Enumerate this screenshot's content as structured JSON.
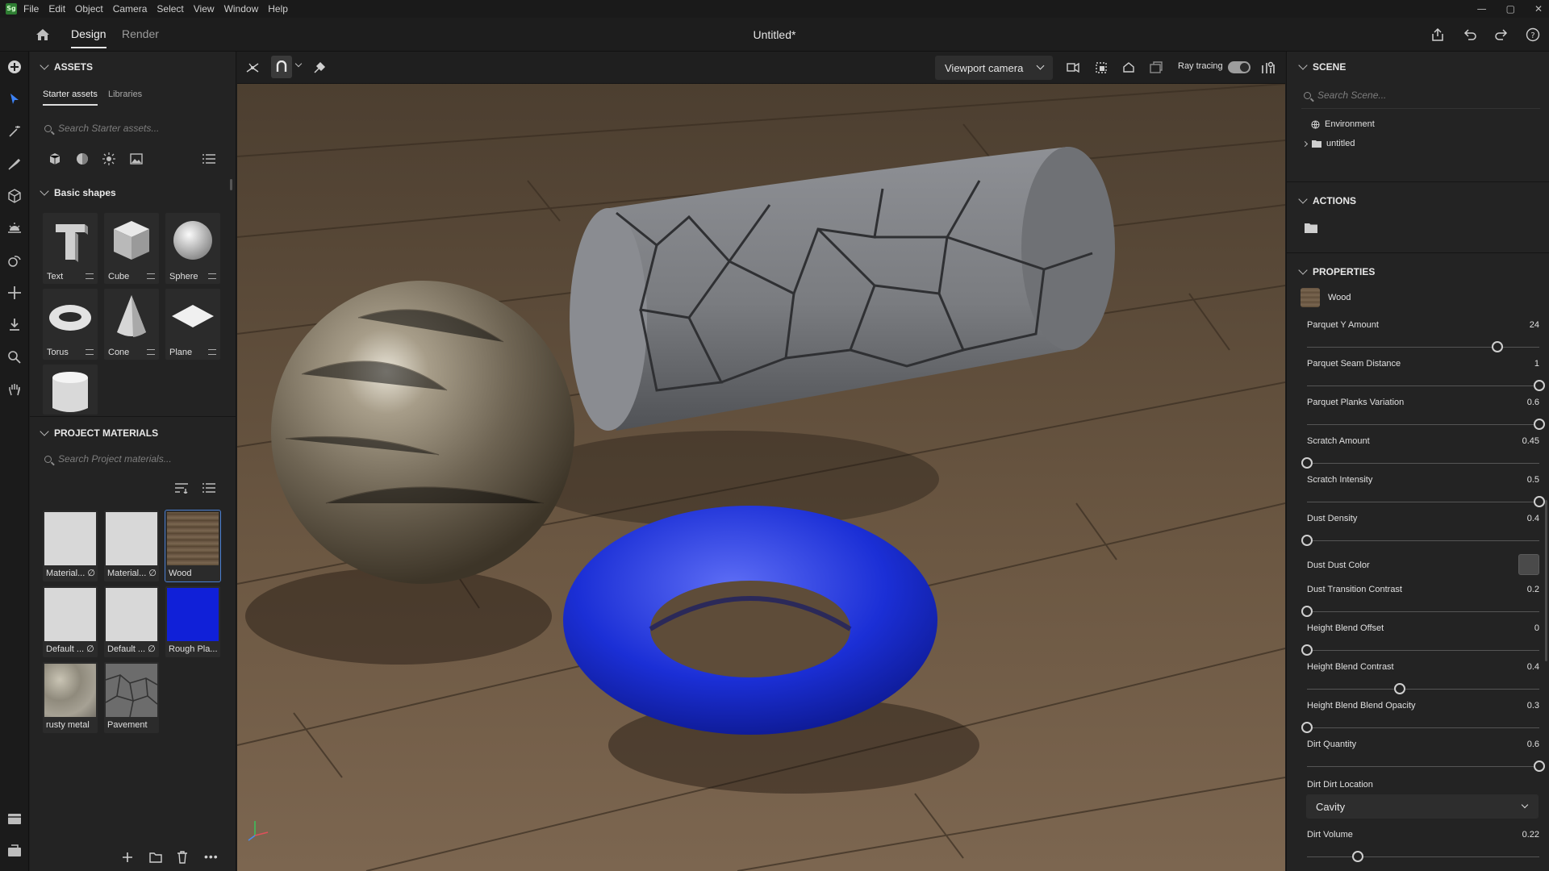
{
  "app": {
    "logo": "Sg",
    "menu": [
      "File",
      "Edit",
      "Object",
      "Camera",
      "Select",
      "View",
      "Window",
      "Help"
    ],
    "title": "Untitled*",
    "window_controls": [
      "—",
      "▢",
      "✕"
    ]
  },
  "header": {
    "tabs": [
      {
        "label": "Design",
        "active": true
      },
      {
        "label": "Render",
        "active": false
      }
    ],
    "right_icons": [
      "share-icon",
      "undo-icon",
      "redo-icon",
      "help-icon"
    ]
  },
  "toolbar": {
    "tools": [
      "add-icon",
      "select-icon",
      "magic-wand-icon",
      "paint-icon",
      "object-icon",
      "light-icon",
      "transform-icon",
      "move-icon",
      "drop-to-floor-icon",
      "zoom-icon",
      "pan-icon"
    ],
    "bottom_tools": [
      "archive-icon",
      "layers-icon"
    ]
  },
  "assets": {
    "section_title": "ASSETS",
    "tabs": [
      "Starter assets",
      "Libraries"
    ],
    "search_placeholder": "Search Starter assets...",
    "filter_icons": [
      "models-icon",
      "materials-icon",
      "lights-icon",
      "images-icon"
    ],
    "basic_shapes_title": "Basic shapes",
    "shapes": [
      {
        "label": "Text"
      },
      {
        "label": "Cube"
      },
      {
        "label": "Sphere"
      },
      {
        "label": "Torus"
      },
      {
        "label": "Cone"
      },
      {
        "label": "Plane"
      },
      {
        "label": ""
      }
    ]
  },
  "project_materials": {
    "section_title": "PROJECT MATERIALS",
    "search_placeholder": "Search Project materials...",
    "materials": [
      {
        "label": "Material... ∅",
        "color": "#d6d6d6"
      },
      {
        "label": "Material... ∅",
        "color": "#d6d6d6"
      },
      {
        "label": "Wood",
        "color": "#6b5a45",
        "selected": true
      },
      {
        "label": "Default ... ∅",
        "color": "#d6d6d6"
      },
      {
        "label": "Default ... ∅",
        "color": "#d6d6d6"
      },
      {
        "label": "Rough Pla...",
        "color": "#1020d8"
      },
      {
        "label": "rusty metal",
        "color": "#9a968c"
      },
      {
        "label": "Pavement",
        "color": "#6a6a6a"
      }
    ],
    "footer_icons": [
      "add-icon",
      "folder-icon",
      "trash-icon",
      "more-icon"
    ]
  },
  "viewport": {
    "camera_select": "Viewport camera",
    "ray_tracing_label": "Ray tracing",
    "ray_tracing_on": true,
    "floor_color": "#5c4a36",
    "sphere_color": "#7d7160",
    "cylinder_color": "#7c7e83",
    "torus_color": "#1b2fd6"
  },
  "scene": {
    "section_title": "SCENE",
    "search_placeholder": "Search Scene...",
    "items": [
      {
        "label": "Environment"
      },
      {
        "label": "untitled"
      }
    ]
  },
  "actions": {
    "section_title": "ACTIONS"
  },
  "properties": {
    "section_title": "PROPERTIES",
    "material_name": "Wood",
    "params": [
      {
        "label": "Parquet Y Amount",
        "value": "24",
        "pos": 0.82
      },
      {
        "label": "Parquet Seam Distance",
        "value": "1",
        "pos": 1.0
      },
      {
        "label": "Parquet Planks Variation",
        "value": "0.6",
        "pos": 1.0
      },
      {
        "label": "Scratch Amount",
        "value": "0.45",
        "pos": 0.0
      },
      {
        "label": "Scratch Intensity",
        "value": "0.5",
        "pos": 1.0
      },
      {
        "label": "Dust Density",
        "value": "0.4",
        "pos": 0.0
      },
      {
        "label": "Dust Transition Contrast",
        "value": "0.2",
        "pos": 0.0
      },
      {
        "label": "Height Blend Offset",
        "value": "0",
        "pos": 0.0
      },
      {
        "label": "Height Blend Contrast",
        "value": "0.4",
        "pos": 0.4
      },
      {
        "label": "Height Blend Blend Opacity",
        "value": "0.3",
        "pos": 0.0
      },
      {
        "label": "Dirt Quantity",
        "value": "0.6",
        "pos": 1.0
      }
    ],
    "dust_color_label": "Dust Dust Color",
    "dust_color": "#4a4a4a",
    "dirt_location_label": "Dirt Dirt Location",
    "dirt_location_value": "Cavity",
    "dirt_volume_label": "Dirt Volume",
    "dirt_volume_value": "0.22",
    "dirt_volume_pos": 0.22
  }
}
